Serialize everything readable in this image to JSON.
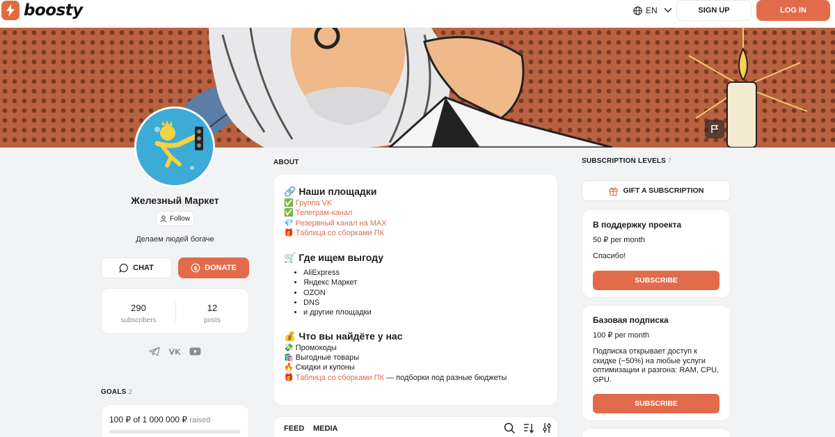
{
  "header": {
    "logo_text": "boosty",
    "lang": "EN",
    "sign_up": "SIGN UP",
    "log_in": "LOG IN"
  },
  "profile": {
    "name": "Железный Маркет",
    "follow": "Follow",
    "tagline": "Делаем людей богаче",
    "chat": "CHAT",
    "donate": "DONATE",
    "stats": [
      {
        "value": "290",
        "label": "subscribers"
      },
      {
        "value": "12",
        "label": "posts"
      }
    ],
    "socials": [
      "telegram-icon",
      "vk-icon",
      "youtube-icon"
    ]
  },
  "goals": {
    "title": "GOALS",
    "count": "2",
    "goal_amount": "100 ₽ of 1 000 000 ₽",
    "goal_suffix": "raised",
    "progress": 0.0001
  },
  "about": {
    "title": "ABOUT",
    "sec1_title": "🔗 Наши площадки",
    "links": [
      {
        "emoji": "✅",
        "text": "Группа VK"
      },
      {
        "emoji": "✅",
        "text": "Телеграм-канал"
      },
      {
        "emoji": "💎",
        "text": "Резервный канал на MAX"
      },
      {
        "emoji": "🎁",
        "text": "Таблица со сборками ПК"
      }
    ],
    "sec2_title": "🛒 Где ищем выгоду",
    "shops": [
      "AliExpress",
      "Яндекс Маркет",
      "OZON",
      "DNS",
      "и другие площадки"
    ],
    "sec3_title": "💰 Что вы найдёте у нас",
    "finds": [
      {
        "emoji": "💸",
        "text": "Промокоды"
      },
      {
        "emoji": "🛍️",
        "text": "Выгодные товары"
      },
      {
        "emoji": "🔥",
        "text": "Скидки и купоны"
      }
    ],
    "last_emoji": "🎁",
    "last_link": "Таблица со сборками ПК",
    "last_rest": " — подборки под разные бюджеты"
  },
  "feed": {
    "tab1": "FEED",
    "tab2": "MEDIA"
  },
  "subscriptions": {
    "title": "SUBSCRIPTION LEVELS",
    "count": "7",
    "gift": "GIFT A SUBSCRIPTION",
    "tiers": [
      {
        "name": "В поддержку проекта",
        "price": "50 ₽ per month",
        "desc": "Спасибо!",
        "button": "SUBSCRIBE"
      },
      {
        "name": "Базовая подписка",
        "price": "100 ₽ per month",
        "desc": "Подписка открывает доступ к скидке (−50%) на любые услуги оптимизации и разгона: RAM, CPU, GPU.",
        "button": "SUBSCRIBE"
      }
    ]
  },
  "colors": {
    "accent": "#e26b4b",
    "background": "#f2f3f5",
    "link": "#e26b4b"
  }
}
